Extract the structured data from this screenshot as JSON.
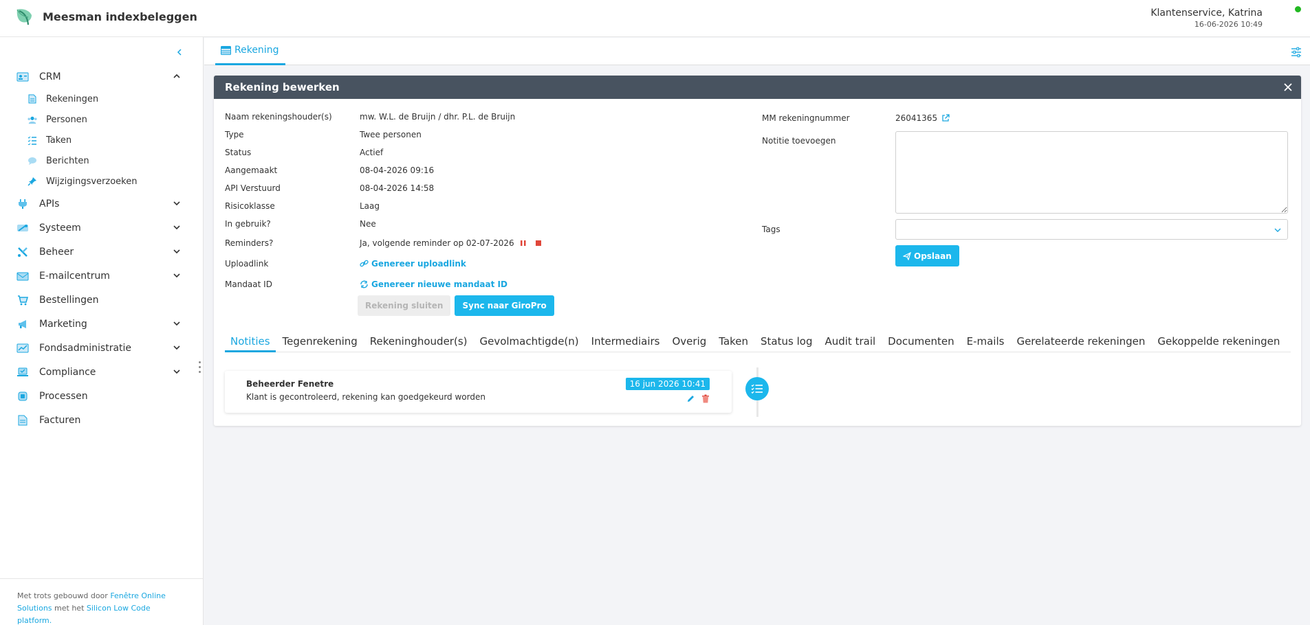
{
  "header": {
    "app_name": "Meesman indexbeleggen",
    "user_name": "Klantenservice, Katrina",
    "datetime": "16-06-2026 10:49"
  },
  "sidebar": {
    "crm_label": "CRM",
    "crm_sub": {
      "rekeningen": "Rekeningen",
      "personen": "Personen",
      "taken": "Taken",
      "berichten": "Berichten",
      "wijzigingsverzoeken": "Wijzigingsverzoeken"
    },
    "items": {
      "apis": "APIs",
      "systeem": "Systeem",
      "beheer": "Beheer",
      "emailcentrum": "E-mailcentrum",
      "bestellingen": "Bestellingen",
      "marketing": "Marketing",
      "fondsadministratie": "Fondsadministratie",
      "compliance": "Compliance",
      "processen": "Processen",
      "facturen": "Facturen"
    },
    "footer": {
      "prefix": "Met trots gebouwd door ",
      "link1": "Fenêtre Online Solutions",
      "middle": " met het ",
      "link2": "Silicon Low Code platform."
    }
  },
  "tabbar": {
    "active_tab": "Rekening"
  },
  "panel": {
    "title": "Rekening bewerken",
    "fields": {
      "naam_label": "Naam rekeningshouder(s)",
      "naam_value": "mw. W.L. de Bruijn / dhr. P.L. de Bruijn",
      "type_label": "Type",
      "type_value": "Twee personen",
      "status_label": "Status",
      "status_value": "Actief",
      "aangemaakt_label": "Aangemaakt",
      "aangemaakt_value": "08-04-2026 09:16",
      "api_label": "API Verstuurd",
      "api_value": "08-04-2026 14:58",
      "risico_label": "Risicoklasse",
      "risico_value": "Laag",
      "ingebruik_label": "In gebruik?",
      "ingebruik_value": "Nee",
      "reminders_label": "Reminders?",
      "reminders_value": "Ja, volgende reminder op 02-07-2026",
      "upload_label": "Uploadlink",
      "upload_link": "Genereer uploadlink",
      "mandaat_label": "Mandaat ID",
      "mandaat_link": "Genereer nieuwe mandaat ID"
    },
    "buttons": {
      "sluiten": "Rekening sluiten",
      "sync": "Sync naar GiroPro"
    },
    "right": {
      "mm_label": "MM rekeningnummer",
      "mm_value": "26041365",
      "notitie_label": "Notitie toevoegen",
      "notitie_value": "",
      "tags_label": "Tags",
      "save_label": "Opslaan"
    },
    "subtabs": [
      "Notities",
      "Tegenrekening",
      "Rekeninghouder(s)",
      "Gevolmachtigde(n)",
      "Intermediairs",
      "Overig",
      "Taken",
      "Status log",
      "Audit trail",
      "Documenten",
      "E-mails",
      "Gerelateerde rekeningen",
      "Gekoppelde rekeningen"
    ],
    "note": {
      "author": "Beheerder Fenetre",
      "text": "Klant is gecontroleerd, rekening kan goedgekeurd worden",
      "timestamp": "16 jun 2026 10:41"
    }
  },
  "colors": {
    "accent": "#1aa7e0",
    "header_bar": "#485360",
    "status_online": "#22b822",
    "danger": "#e0473a"
  }
}
